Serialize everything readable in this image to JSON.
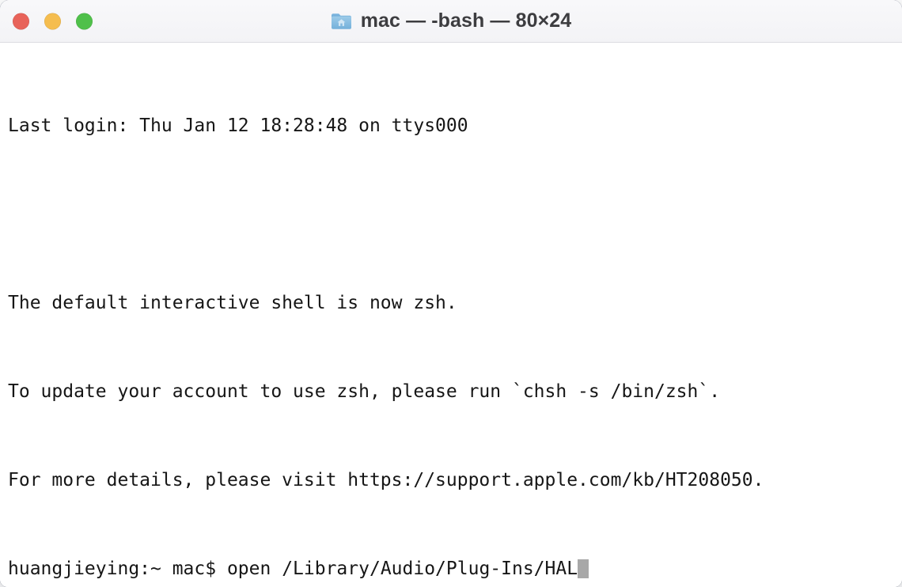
{
  "window": {
    "title": "mac — -bash — 80×24",
    "icon": "home-folder-icon",
    "traffic_lights": {
      "close_label": "Close",
      "minimize_label": "Minimize",
      "maximize_label": "Zoom",
      "close_color": "#e8635a",
      "minimize_color": "#f5bd4f",
      "maximize_color": "#4fc04a"
    },
    "columns": 80,
    "rows": 24
  },
  "terminal": {
    "background_color": "#ffffff",
    "text_color": "#161616",
    "cursor_color": "#a8a8a8",
    "lines": [
      "Last login: Thu Jan 12 18:28:48 on ttys000",
      "",
      "The default interactive shell is now zsh.",
      "To update your account to use zsh, please run `chsh -s /bin/zsh`.",
      "For more details, please visit https://support.apple.com/kb/HT208050."
    ],
    "prompt": "huangjieying:~ mac$ ",
    "command": "open /Library/Audio/Plug-Ins/HAL"
  }
}
